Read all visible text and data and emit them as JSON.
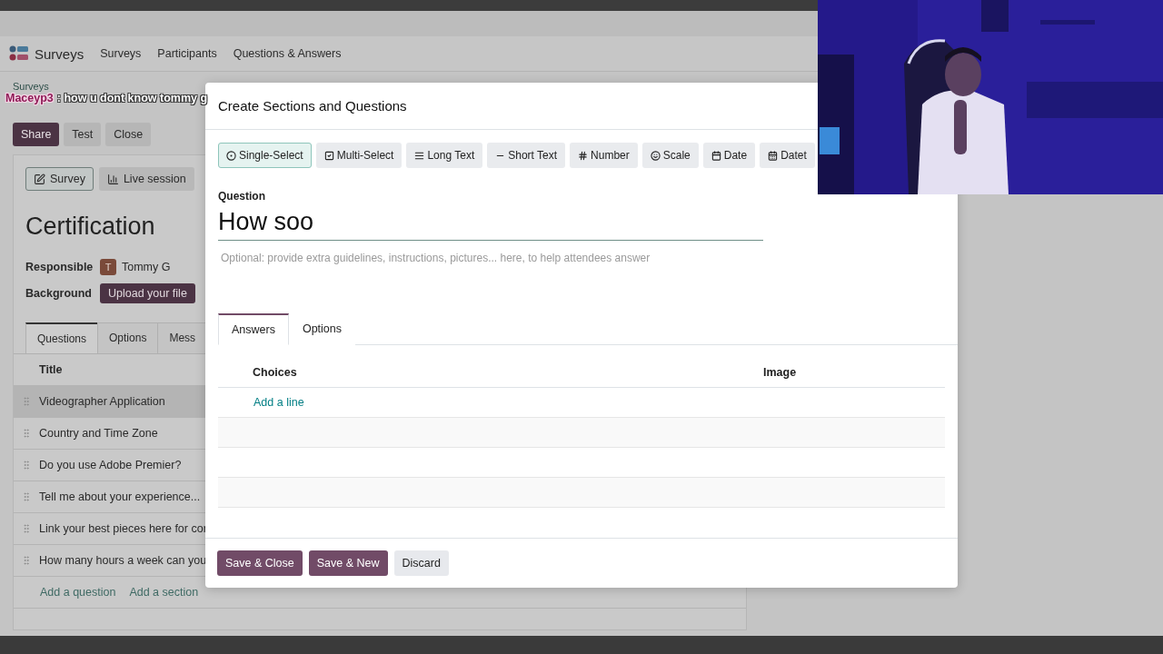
{
  "app": {
    "brand": "Surveys",
    "menu": [
      "Surveys",
      "Participants",
      "Questions & Answers"
    ]
  },
  "breadcrumb": "Surveys",
  "actions": [
    {
      "label": "Share",
      "kind": "primary"
    },
    {
      "label": "Test",
      "kind": "secondary"
    },
    {
      "label": "Close",
      "kind": "secondary"
    }
  ],
  "form": {
    "views": [
      {
        "label": "Survey",
        "selected": true
      },
      {
        "label": "Live session",
        "selected": false
      }
    ],
    "title": "Certification",
    "fields": [
      {
        "label": "Responsible",
        "kind": "user",
        "initial": "T",
        "value": "Tommy G"
      },
      {
        "label": "Background",
        "kind": "upload",
        "value": "Upload your file"
      }
    ],
    "tabs": [
      {
        "label": "Questions",
        "selected": true
      },
      {
        "label": "Options",
        "selected": false
      },
      {
        "label": "Mess",
        "selected": false
      }
    ],
    "table": {
      "columns": [
        "Title"
      ],
      "rows": [
        {
          "title": "Videographer Application",
          "selected": true
        },
        {
          "title": "Country and Time Zone",
          "selected": false
        },
        {
          "title": "Do you use Adobe Premier?",
          "selected": false
        },
        {
          "title": "Tell me about your experience...",
          "selected": false
        },
        {
          "title": "Link your best pieces here for cor",
          "selected": false
        },
        {
          "title": "How many hours a week can you",
          "selected": false
        }
      ],
      "links": [
        "Add a question",
        "Add a section"
      ]
    }
  },
  "chat_overlay": {
    "user": "Maceyp3",
    "message": ": how u dont know tommy g"
  },
  "dialog": {
    "title": "Create Sections and Questions",
    "types": [
      {
        "label": "Single-Select",
        "selected": true
      },
      {
        "label": "Multi-Select",
        "selected": false
      },
      {
        "label": "Long Text",
        "selected": false
      },
      {
        "label": "Short Text",
        "selected": false
      },
      {
        "label": "Number",
        "selected": false
      },
      {
        "label": "Scale",
        "selected": false
      },
      {
        "label": "Date",
        "selected": false
      },
      {
        "label": "Datet",
        "selected": false
      }
    ],
    "question_label": "Question",
    "question_value": "How soo",
    "description_placeholder": "Optional: provide extra guidelines, instructions, pictures... here, to help attendees answer",
    "tabs": [
      {
        "label": "Answers",
        "selected": true
      },
      {
        "label": "Options",
        "selected": false
      }
    ],
    "columns": [
      "Choices",
      "Image"
    ],
    "add_line": "Add a line",
    "buttons": [
      {
        "label": "Save & Close",
        "kind": "primary"
      },
      {
        "label": "Save & New",
        "kind": "primary"
      },
      {
        "label": "Discard",
        "kind": "secondary"
      }
    ]
  }
}
